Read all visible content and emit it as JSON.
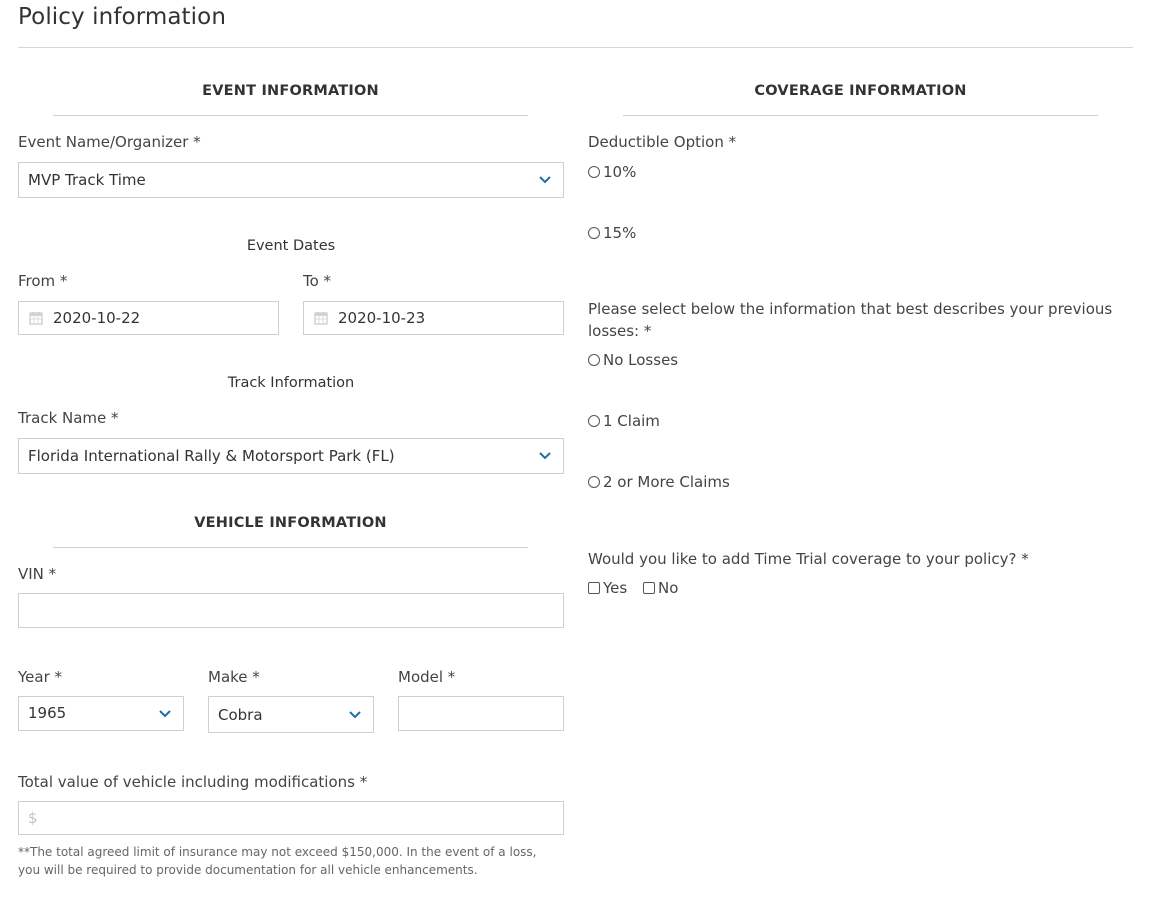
{
  "page": {
    "title": "Policy information"
  },
  "event": {
    "section_title": "EVENT INFORMATION",
    "organizer_label": "Event Name/Organizer *",
    "organizer_value": "MVP Track Time",
    "dates_title": "Event Dates",
    "from_label": "From *",
    "from_value": "2020-10-22",
    "to_label": "To *",
    "to_value": "2020-10-23",
    "track_title": "Track Information",
    "track_label": "Track Name *",
    "track_value": "Florida International Rally & Motorsport Park (FL)"
  },
  "vehicle": {
    "section_title": "VEHICLE INFORMATION",
    "vin_label": "VIN *",
    "vin_value": "",
    "year_label": "Year *",
    "year_value": "1965",
    "make_label": "Make *",
    "make_value": "Cobra",
    "model_label": "Model *",
    "model_value": "",
    "value_label": "Total value of vehicle including modifications *",
    "value_placeholder": "$",
    "note": "**The total agreed limit of insurance may not exceed $150,000. In the event of a loss, you will be required to provide documentation for all vehicle enhancements."
  },
  "coverage": {
    "section_title": "COVERAGE INFORMATION",
    "deductible_label": "Deductible Option *",
    "deductible_options": [
      "10%",
      "15%"
    ],
    "losses_question": "Please select below the information that best describes your previous losses: *",
    "loss_options": [
      "No Losses",
      "1 Claim",
      "2 or More Claims"
    ],
    "time_trial_question": "Would you like to add Time Trial coverage to your policy? *",
    "time_trial_options": [
      "Yes",
      "No"
    ]
  },
  "colors": {
    "accent": "#1f6fa8",
    "border": "#cfcfcf",
    "text": "#444444"
  },
  "icons": {
    "dropdown": "chevron-down-icon",
    "date": "calendar-icon"
  }
}
